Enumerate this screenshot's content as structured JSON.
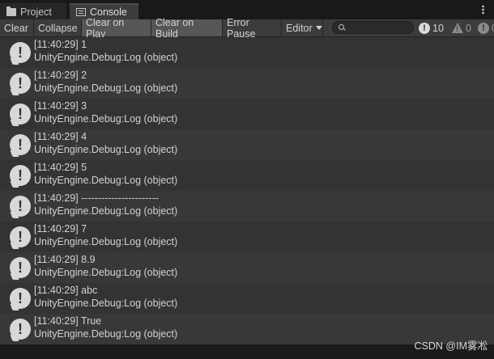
{
  "tabs": [
    {
      "label": "Project",
      "icon": "folder-icon"
    },
    {
      "label": "Console",
      "icon": "console-icon"
    }
  ],
  "toolbar": {
    "clear": "Clear",
    "collapse": "Collapse",
    "clear_on_play": "Clear on Play",
    "clear_on_build": "Clear on Build",
    "error_pause": "Error Pause",
    "editor": "Editor",
    "search_value": "",
    "log_count": "10",
    "warning_count": "0",
    "error_count": "0"
  },
  "logs": [
    {
      "message": "[11:40:29] 1",
      "source": "UnityEngine.Debug:Log (object)"
    },
    {
      "message": "[11:40:29] 2",
      "source": "UnityEngine.Debug:Log (object)"
    },
    {
      "message": "[11:40:29] 3",
      "source": "UnityEngine.Debug:Log (object)"
    },
    {
      "message": "[11:40:29] 4",
      "source": "UnityEngine.Debug:Log (object)"
    },
    {
      "message": "[11:40:29] 5",
      "source": "UnityEngine.Debug:Log (object)"
    },
    {
      "message": "[11:40:29] -----------------------",
      "source": "UnityEngine.Debug:Log (object)"
    },
    {
      "message": "[11:40:29] 7",
      "source": "UnityEngine.Debug:Log (object)"
    },
    {
      "message": "[11:40:29] 8.9",
      "source": "UnityEngine.Debug:Log (object)"
    },
    {
      "message": "[11:40:29] abc",
      "source": "UnityEngine.Debug:Log (object)"
    },
    {
      "message": "[11:40:29] True",
      "source": "UnityEngine.Debug:Log (object)"
    }
  ],
  "watermark": "CSDN @IM雾凇"
}
